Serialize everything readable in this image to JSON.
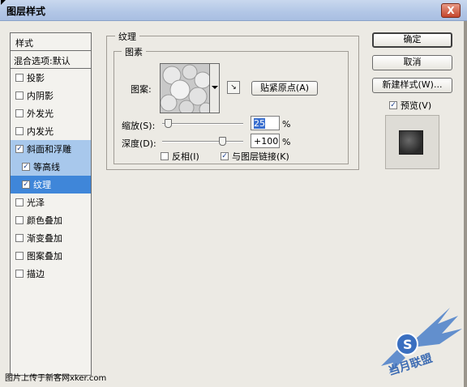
{
  "window": {
    "title": "图层样式",
    "close_label": "X"
  },
  "style_list": {
    "header": "样式",
    "blend_options": "混合选项:默认",
    "items": [
      {
        "label": "投影",
        "checked": false
      },
      {
        "label": "内阴影",
        "checked": false
      },
      {
        "label": "外发光",
        "checked": false
      },
      {
        "label": "内发光",
        "checked": false
      },
      {
        "label": "斜面和浮雕",
        "checked": true
      },
      {
        "label": "等高线",
        "checked": true
      },
      {
        "label": "纹理",
        "checked": true
      },
      {
        "label": "光泽",
        "checked": false
      },
      {
        "label": "颜色叠加",
        "checked": false
      },
      {
        "label": "渐变叠加",
        "checked": false
      },
      {
        "label": "图案叠加",
        "checked": false
      },
      {
        "label": "描边",
        "checked": false
      }
    ],
    "check_glyph": "✓"
  },
  "texture": {
    "group_title": "纹理",
    "subgroup_title": "图素",
    "pattern_label": "图案:",
    "snap_origin_button": "贴紧原点(A)",
    "scale_label": "缩放(S):",
    "scale_value": "25",
    "scale_unit": "%",
    "scale_percent": 25,
    "depth_label": "深度(D):",
    "depth_value": "+100",
    "depth_unit": "%",
    "depth_percent": 100,
    "invert_label": "反相(I)",
    "invert_checked": false,
    "link_label": "与图层链接(K)",
    "link_checked": true
  },
  "buttons": {
    "ok": "确定",
    "cancel": "取消",
    "new_style": "新建样式(W)...",
    "preview_label": "预览(V)",
    "preview_checked": true
  },
  "footer": {
    "caption": "图片上传于新客网xker.com",
    "watermark_text": "当月联盟"
  },
  "colors": {
    "selected_row": "#3f86d9",
    "selected_parent_row": "#a8c8ec",
    "dialog_bg": "#eceae4"
  }
}
